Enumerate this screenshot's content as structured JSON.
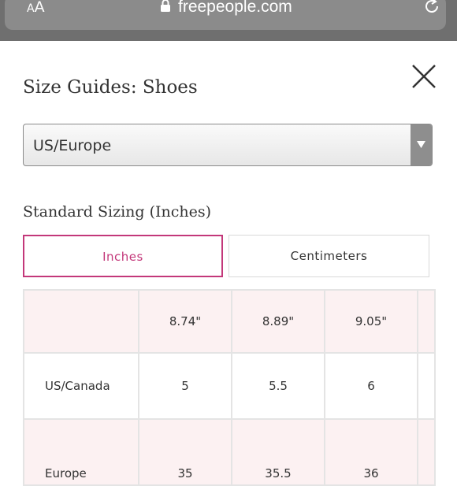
{
  "browser": {
    "text_size_small": "A",
    "text_size_big": "A",
    "url": "freepeople.com"
  },
  "modal": {
    "title": "Size Guides: Shoes",
    "region_select": {
      "value": "US/Europe"
    },
    "section_title": "Standard Sizing (Inches)",
    "tabs": [
      {
        "label": "Inches",
        "active": true
      },
      {
        "label": "Centimeters",
        "active": false
      }
    ],
    "table": {
      "rows": [
        {
          "label": "",
          "cells": [
            "8.74\"",
            "8.89\"",
            "9.05\"",
            ""
          ]
        },
        {
          "label": "US/Canada",
          "cells": [
            "5",
            "5.5",
            "6",
            ""
          ]
        },
        {
          "label": "Europe",
          "cells": [
            "35",
            "35.5",
            "36",
            ""
          ]
        }
      ]
    }
  },
  "colors": {
    "accent": "#c3387a",
    "header_row_bg": "#fcf1f2",
    "browser_bar": "#6f6f6f"
  }
}
